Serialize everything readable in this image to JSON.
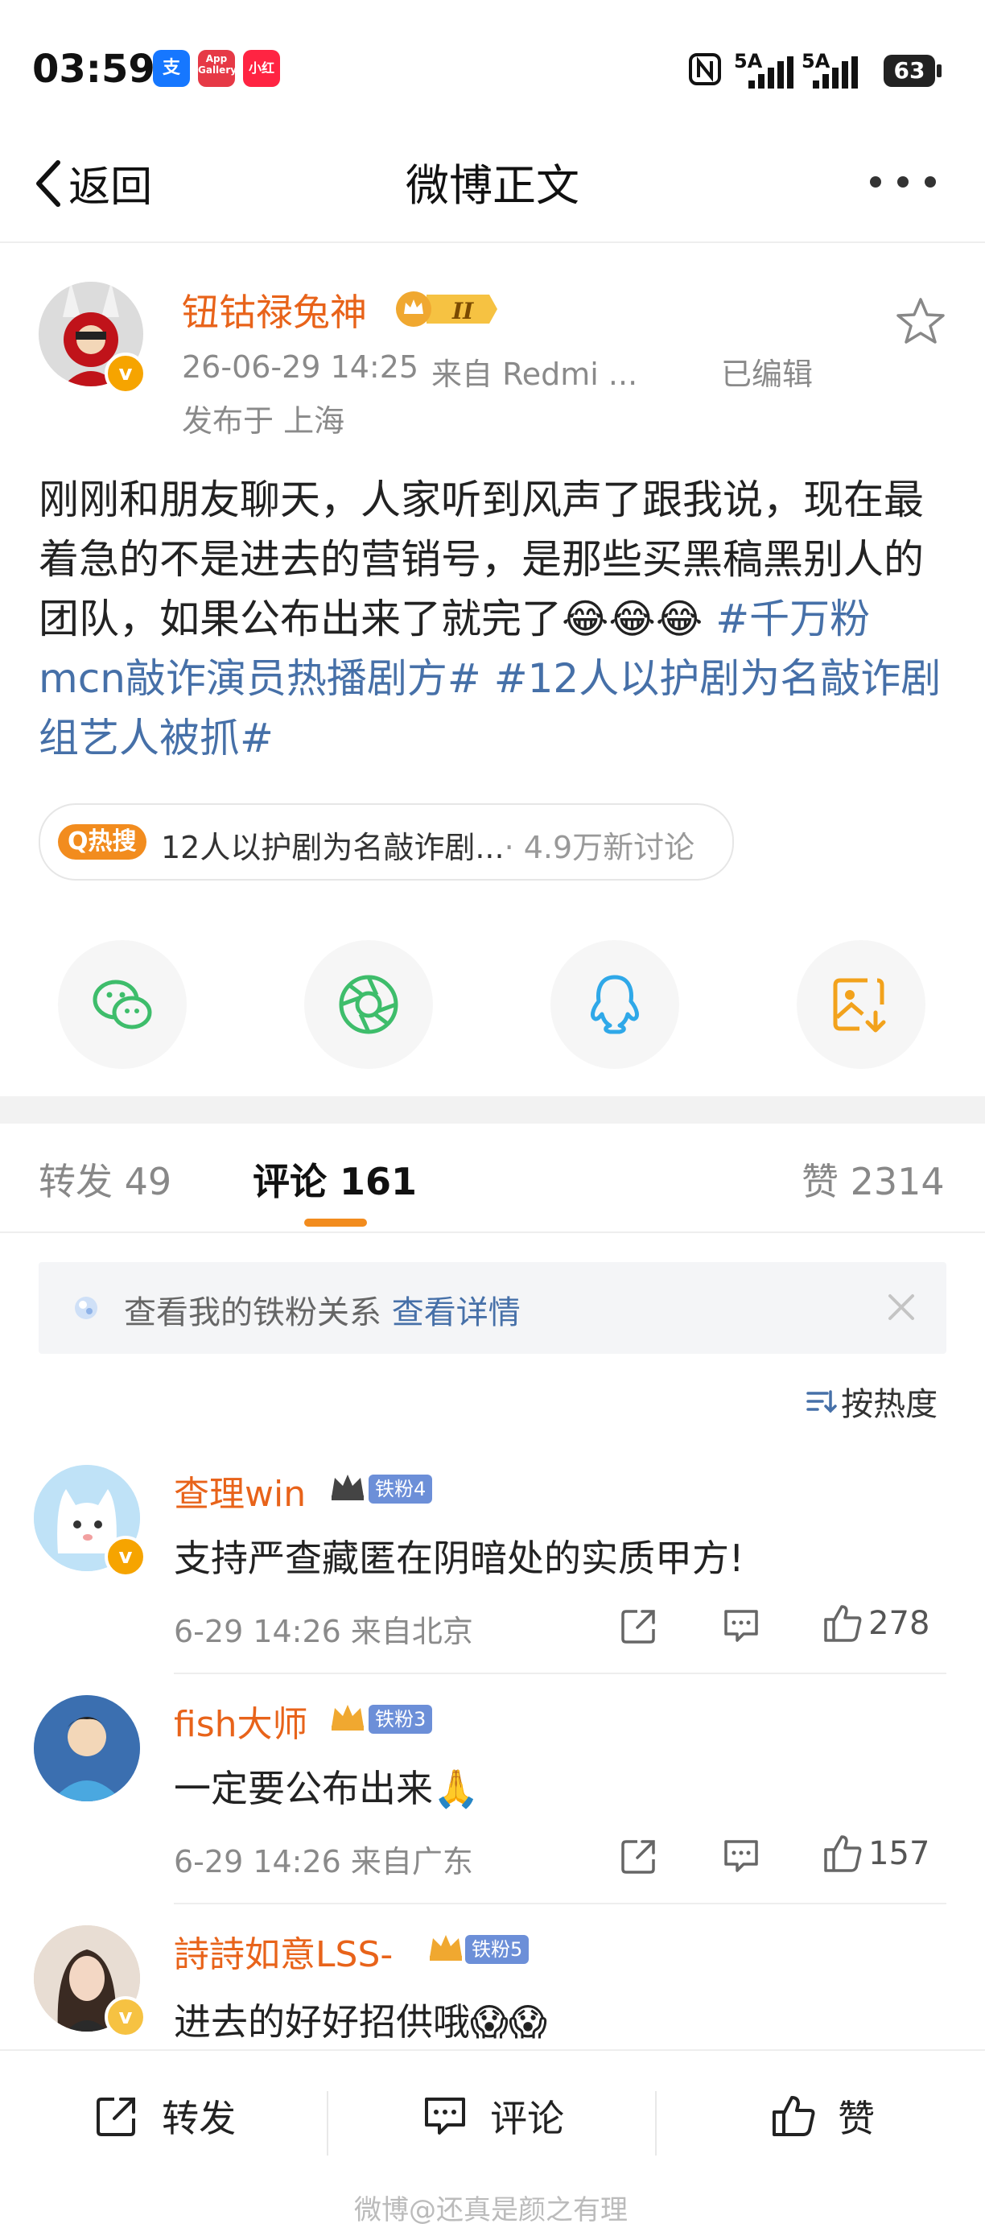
{
  "status_bar": {
    "time": "03:59",
    "apps": [
      {
        "name": "alipay-icon",
        "label": "支",
        "color": "#1677ff"
      },
      {
        "name": "app-gallery-icon",
        "label": "App Gallery",
        "color": "#e63946"
      },
      {
        "name": "xiaohongshu-icon",
        "label": "小红书",
        "color": "#ff2442"
      }
    ],
    "signal1": "5A",
    "signal2": "5A",
    "battery": "63"
  },
  "nav": {
    "back_label": "返回",
    "title": "微博正文",
    "more_icon": "more-icon"
  },
  "post": {
    "username": "钮钴禄兔神",
    "vip_badge": "II",
    "timestamp": "26-06-29 14:25",
    "source": "来自 Redmi ...",
    "edited": "已编辑",
    "location": "发布于 上海",
    "text_plain": "刚刚和朋友聊天，人家听到风声了跟我说，现在最着急的不是进去的营销号，是那些买黑稿黑别人的团队，如果公布出来了就完了",
    "emoji": "😂😂😂",
    "tag1": "#千万粉mcn敲诈演员热播剧方#",
    "tag2": "#12人以护剧为名敲诈剧组艺人被抓#",
    "hot_badge": "Q热搜",
    "hot_text": "12人以护剧为名敲诈剧...",
    "hot_count": "· 4.9万新讨论"
  },
  "share": [
    "wechat-icon",
    "moments-icon",
    "qq-icon",
    "save-image-icon"
  ],
  "tabs": {
    "repost": "转发 49",
    "comment": "评论 161",
    "like": "赞 2314"
  },
  "fan_box": {
    "text": "查看我的铁粉关系",
    "link": "查看详情"
  },
  "sort_label": "按热度",
  "comments": [
    {
      "name": "查理win",
      "fan_tag": "铁粉4",
      "text": "支持严查藏匿在阴暗处的实质甲方!",
      "meta": "6-29 14:26 来自北京",
      "likes": "278"
    },
    {
      "name": "fish大师",
      "fan_tag": "铁粉3",
      "text": "一定要公布出来🙏",
      "meta": "6-29 14:26 来自广东",
      "likes": "157"
    },
    {
      "name": "詩詩如意LSS-",
      "fan_tag": "铁粉5",
      "text": "进去的好好招供哦😱😱",
      "meta": "",
      "likes": ""
    }
  ],
  "bottom_bar": {
    "repost": "转发",
    "comment": "评论",
    "like": "赞"
  },
  "watermark": "微博@还真是颜之有理",
  "colors": {
    "username": "#e8631a",
    "link": "#4670a8",
    "accent": "#f28c1e"
  }
}
